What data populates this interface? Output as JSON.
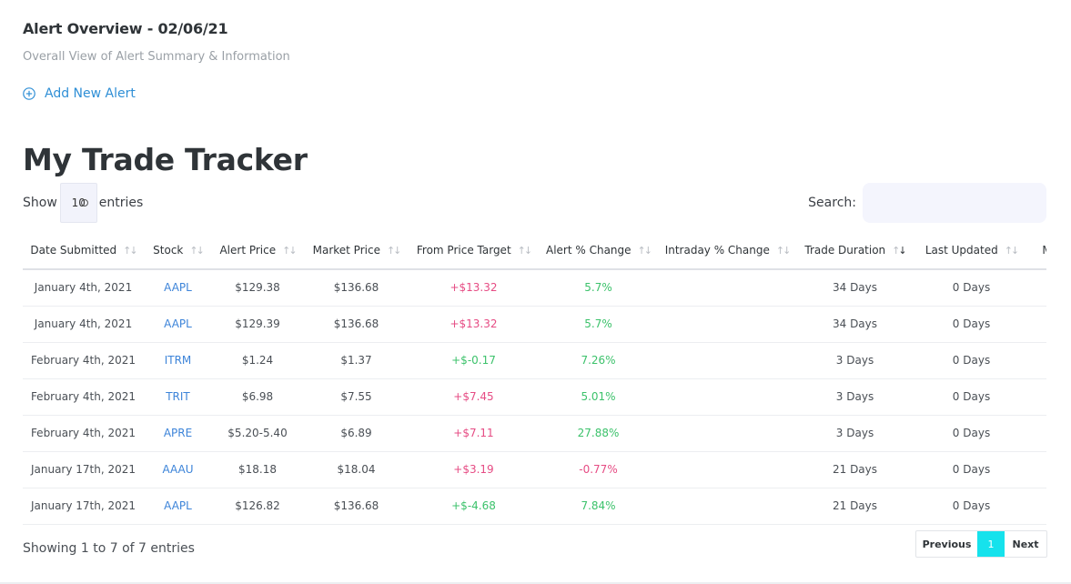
{
  "header": {
    "title": "Alert Overview - 02/06/21",
    "subtitle": "Overall View of Alert Summary & Information",
    "add_alert_label": "Add New Alert"
  },
  "tracker": {
    "heading": "My Trade Tracker",
    "show_label": "Show",
    "entries_label": "entries",
    "length_value": "10",
    "search_label": "Search:",
    "search_value": ""
  },
  "table": {
    "columns": [
      {
        "label": "Date Submitted",
        "sort": "both"
      },
      {
        "label": "Stock",
        "sort": "both"
      },
      {
        "label": "Alert Price",
        "sort": "both"
      },
      {
        "label": "Market Price",
        "sort": "both"
      },
      {
        "label": "From Price Target",
        "sort": "both"
      },
      {
        "label": "Alert % Change",
        "sort": "both"
      },
      {
        "label": "Intraday % Change",
        "sort": "both"
      },
      {
        "label": "Trade Duration",
        "sort": "desc"
      },
      {
        "label": "Last Updated",
        "sort": "both"
      },
      {
        "label": "Mo",
        "sort": "both"
      }
    ],
    "rows": [
      {
        "date": "January 4th, 2021",
        "stock": "AAPL",
        "alert_price": "$129.38",
        "market_price": "$136.68",
        "from_target": "+$13.32",
        "from_target_tone": "neg",
        "alert_change": "5.7%",
        "alert_change_tone": "pos",
        "intraday": "",
        "duration": "34 Days",
        "updated": "0 Days"
      },
      {
        "date": "January 4th, 2021",
        "stock": "AAPL",
        "alert_price": "$129.39",
        "market_price": "$136.68",
        "from_target": "+$13.32",
        "from_target_tone": "neg",
        "alert_change": "5.7%",
        "alert_change_tone": "pos",
        "intraday": "",
        "duration": "34 Days",
        "updated": "0 Days"
      },
      {
        "date": "February 4th, 2021",
        "stock": "ITRM",
        "alert_price": "$1.24",
        "market_price": "$1.37",
        "from_target": "+$-0.17",
        "from_target_tone": "pos",
        "alert_change": "7.26%",
        "alert_change_tone": "pos",
        "intraday": "",
        "duration": "3 Days",
        "updated": "0 Days"
      },
      {
        "date": "February 4th, 2021",
        "stock": "TRIT",
        "alert_price": "$6.98",
        "market_price": "$7.55",
        "from_target": "+$7.45",
        "from_target_tone": "neg",
        "alert_change": "5.01%",
        "alert_change_tone": "pos",
        "intraday": "",
        "duration": "3 Days",
        "updated": "0 Days"
      },
      {
        "date": "February 4th, 2021",
        "stock": "APRE",
        "alert_price": "$5.20-5.40",
        "market_price": "$6.89",
        "from_target": "+$7.11",
        "from_target_tone": "neg",
        "alert_change": "27.88%",
        "alert_change_tone": "pos",
        "intraday": "",
        "duration": "3 Days",
        "updated": "0 Days"
      },
      {
        "date": "January 17th, 2021",
        "stock": "AAAU",
        "alert_price": "$18.18",
        "market_price": "$18.04",
        "from_target": "+$3.19",
        "from_target_tone": "neg",
        "alert_change": "-0.77%",
        "alert_change_tone": "neg",
        "intraday": "",
        "duration": "21 Days",
        "updated": "0 Days"
      },
      {
        "date": "January 17th, 2021",
        "stock": "AAPL",
        "alert_price": "$126.82",
        "market_price": "$136.68",
        "from_target": "+$-4.68",
        "from_target_tone": "pos",
        "alert_change": "7.84%",
        "alert_change_tone": "pos",
        "intraday": "",
        "duration": "21 Days",
        "updated": "0 Days"
      }
    ]
  },
  "footer": {
    "info": "Showing 1 to 7 of 7 entries",
    "prev_label": "Previous",
    "current_page": "1",
    "next_label": "Next"
  },
  "colors": {
    "accent": "#2f8fd6",
    "stock_link": "#3d84d9",
    "negative": "#e64c84",
    "positive": "#3cc26b",
    "page_active": "#16e2ec"
  },
  "icons": {
    "add_alert": "plus-circle-icon",
    "sort_both": "sort-both-icon",
    "sort_desc": "sort-desc-icon"
  }
}
